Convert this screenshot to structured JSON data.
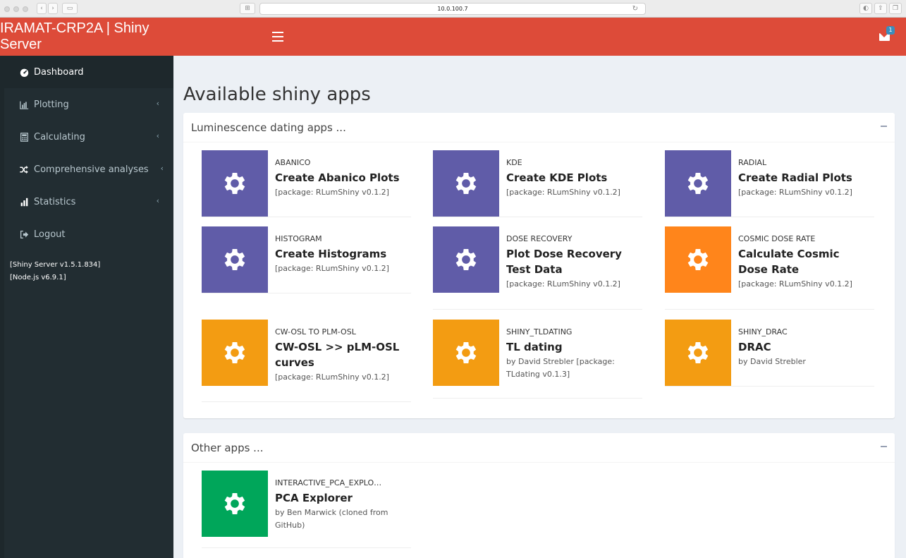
{
  "browser": {
    "url": "10.0.100.7"
  },
  "header": {
    "brand": "IRAMAT-CRP2A | Shiny Server",
    "messages_count": "1"
  },
  "sidebar": {
    "items": [
      {
        "label": "Dashboard",
        "icon": "dashboard-icon",
        "active": true
      },
      {
        "label": "Plotting",
        "icon": "bar-chart-icon"
      },
      {
        "label": "Calculating",
        "icon": "calculator-icon"
      },
      {
        "label": "Comprehensive analyses",
        "icon": "random-icon"
      },
      {
        "label": "Statistics",
        "icon": "signal-icon"
      },
      {
        "label": "Logout",
        "icon": "sign-out-icon"
      }
    ],
    "version_lines": [
      "[Shiny Server v1.5.1.834]",
      "[Node.js v6.9.1]"
    ]
  },
  "main": {
    "title": "Available shiny apps",
    "boxes": [
      {
        "title": "Luminescence dating apps ...",
        "apps": [
          {
            "category": "ABANICO",
            "title": "Create Abanico Plots",
            "info": "[package: RLumShiny v0.1.2]",
            "color": "#605ca8"
          },
          {
            "category": "KDE",
            "title": "Create KDE Plots",
            "info": "[package: RLumShiny v0.1.2]",
            "color": "#605ca8"
          },
          {
            "category": "RADIAL",
            "title": "Create Radial Plots",
            "info": "[package: RLumShiny v0.1.2]",
            "color": "#605ca8"
          },
          {
            "category": "HISTOGRAM",
            "title": "Create Histograms",
            "info": "[package: RLumShiny v0.1.2]",
            "color": "#605ca8"
          },
          {
            "category": "DOSE RECOVERY",
            "title": "Plot Dose Recovery Test Data",
            "info": "[package: RLumShiny v0.1.2]",
            "color": "#605ca8"
          },
          {
            "category": "COSMIC DOSE RATE",
            "title": "Calculate Cosmic Dose Rate",
            "info": "[package: RLumShiny v0.1.2]",
            "color": "#ff851b"
          },
          {
            "category": "CW-OSL TO PLM-OSL",
            "title": "CW-OSL >> pLM-OSL curves",
            "info": "[package: RLumShiny v0.1.2]",
            "color": "#f39c12"
          },
          {
            "category": "SHINY_TLDATING",
            "title": "TL dating",
            "info": "by David Strebler [package: TLdating v0.1.3]",
            "color": "#f39c12"
          },
          {
            "category": "SHINY_DRAC",
            "title": "DRAC",
            "info": "by David Strebler",
            "color": "#f39c12"
          }
        ]
      },
      {
        "title": "Other apps ...",
        "apps": [
          {
            "category": "INTERACTIVE_PCA_EXPLO…",
            "title": "PCA Explorer",
            "info": "by Ben Marwick (cloned from GitHub)",
            "color": "#00a65a"
          }
        ]
      }
    ]
  }
}
